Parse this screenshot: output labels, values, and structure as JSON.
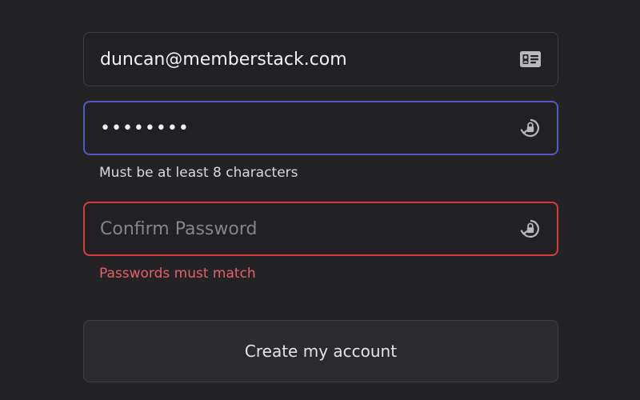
{
  "form": {
    "email": {
      "value": "duncan@memberstack.com",
      "icon": "id-card-icon"
    },
    "password": {
      "value": "••••••••",
      "icon": "lock-refresh-icon",
      "helper": "Must be at least 8 characters",
      "border_color": "#5559c4"
    },
    "confirm_password": {
      "placeholder": "Confirm Password",
      "value": "",
      "icon": "lock-refresh-icon",
      "error": "Passwords must match",
      "border_color": "#d93a3e"
    },
    "submit_label": "Create my account"
  },
  "colors": {
    "background": "#232326",
    "error_text": "#e46166",
    "focus": "#5559c4",
    "error_border": "#d93a3e"
  }
}
